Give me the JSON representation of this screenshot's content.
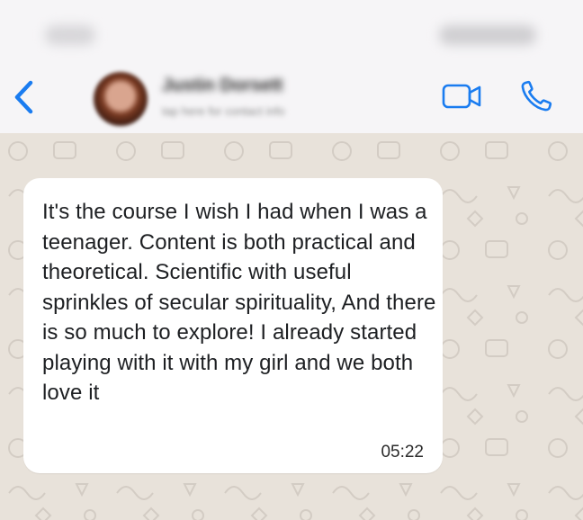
{
  "status_bar": {
    "time": "9:41",
    "indicators": "signal wifi battery"
  },
  "header": {
    "back_icon": "chevron-left-icon",
    "contact_name": "Justin Dorsett",
    "contact_subtitle": "tap here for contact info",
    "video_icon": "video-camera-icon",
    "call_icon": "phone-icon",
    "accent_color": "#1a7cf0"
  },
  "chat": {
    "background_color": "#e8e2da",
    "messages": [
      {
        "text": "It's the course I wish I had when I was a teenager. Content is both practical and theoretical. Scientific with useful sprinkles of secular spirituality, And there is so much to explore! I already started playing with it with my girl and we both love it",
        "time": "05:22"
      }
    ]
  }
}
